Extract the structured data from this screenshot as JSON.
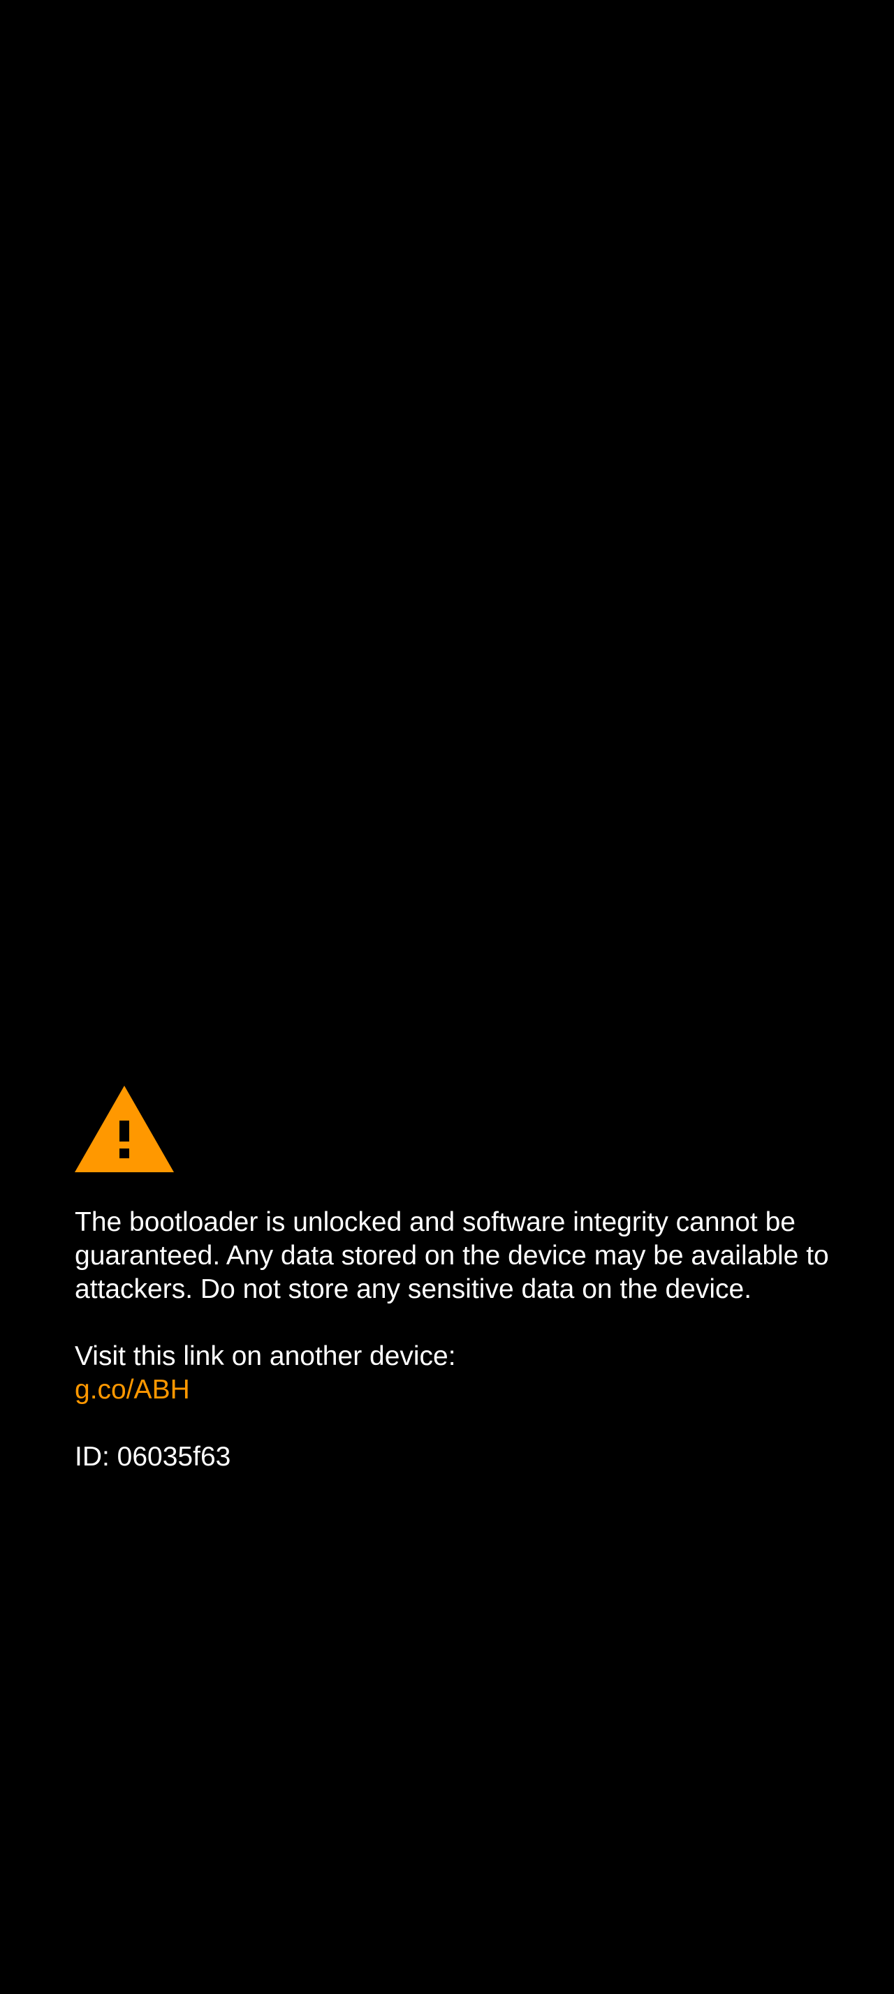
{
  "colors": {
    "background": "#000000",
    "text": "#ffffff",
    "accent": "#ff9800"
  },
  "warning": {
    "icon": "warning-triangle-icon",
    "message": "The bootloader is unlocked and software integrity cannot be guaranteed. Any data stored on the device may be available to attackers. Do not store any sensitive data on the device.",
    "visit_label": "Visit this link on another device:",
    "link_text": "g.co/ABH",
    "device_id": "ID: 06035f63"
  }
}
